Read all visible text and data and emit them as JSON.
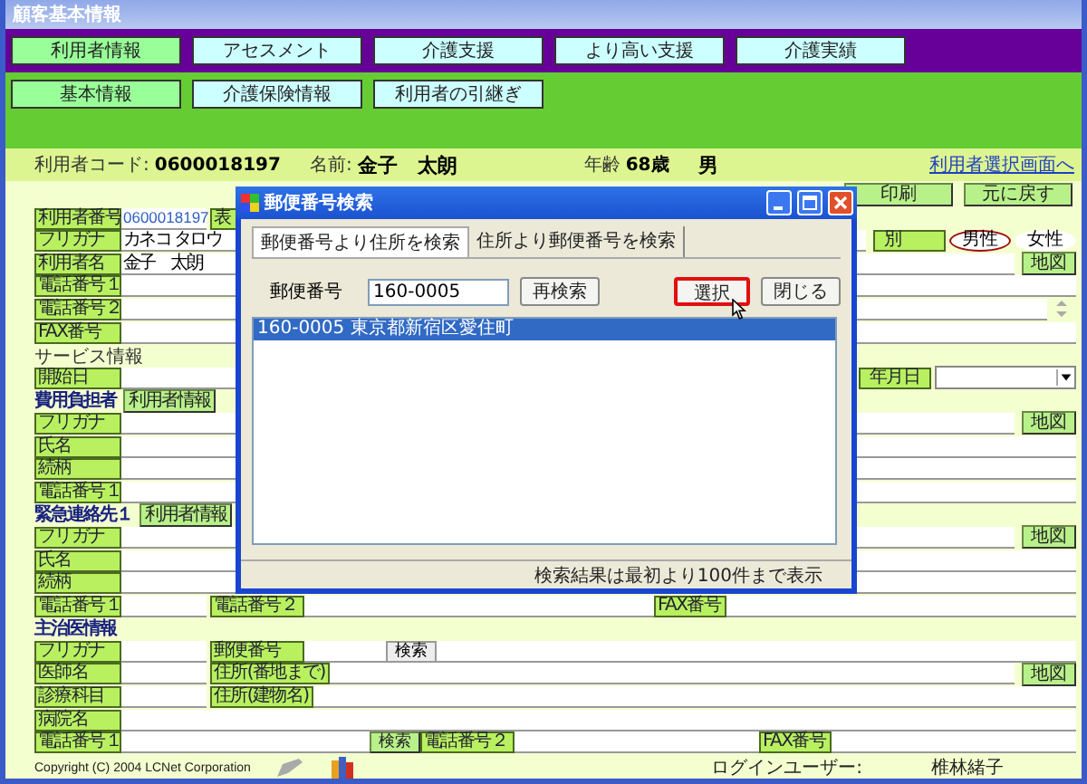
{
  "window": {
    "title": "顧客基本情報"
  },
  "main_tabs": [
    {
      "label": "利用者情報",
      "selected": true
    },
    {
      "label": "アセスメント",
      "selected": false
    },
    {
      "label": "介護支援",
      "selected": false
    },
    {
      "label": "より高い支援",
      "selected": false
    },
    {
      "label": "介護実績",
      "selected": false
    }
  ],
  "sub_tabs": [
    {
      "label": "基本情報",
      "selected": true
    },
    {
      "label": "介護保険情報",
      "selected": false
    },
    {
      "label": "利用者の引継ぎ",
      "selected": false
    }
  ],
  "header": {
    "code_label": "利用者コード:",
    "code": "0600018197",
    "name_label": "名前:",
    "name": "金子　太朗",
    "age_label": "年齢",
    "age": "68歳",
    "sex": "男",
    "link": "利用者選択画面へ"
  },
  "actions": [
    "印刷",
    "元に戻す"
  ],
  "form_rows": [
    {
      "kind": "field",
      "label": "利用者番号",
      "value": "0600018197",
      "readonly": true,
      "extra_label": "表"
    },
    {
      "kind": "field",
      "label": "フリガナ",
      "value": "カネコ タロウ",
      "readonly": false,
      "right": {
        "kind": "gender",
        "label": "別",
        "options": [
          {
            "label": "男性",
            "selected": true
          },
          {
            "label": "女性",
            "selected": false
          }
        ]
      }
    },
    {
      "kind": "field",
      "label": "利用者名",
      "value": "金子　太朗",
      "readonly": false,
      "right": {
        "kind": "button",
        "label": "地図"
      }
    },
    {
      "kind": "field",
      "label": "電話番号１"
    },
    {
      "kind": "field",
      "label": "電話番号２",
      "right": {
        "kind": "scroll"
      }
    },
    {
      "kind": "field",
      "label": "FAX番号"
    },
    {
      "kind": "note",
      "text": "サービス情報"
    },
    {
      "kind": "field",
      "label": "開始日",
      "right": {
        "kind": "date",
        "label": "年月日"
      }
    },
    {
      "kind": "heading",
      "text": "費用負担者",
      "button": "利用者情報"
    },
    {
      "kind": "field",
      "label": "フリガナ",
      "right": {
        "kind": "button",
        "label": "地図"
      }
    },
    {
      "kind": "field",
      "label": "氏名"
    },
    {
      "kind": "field",
      "label": "続柄"
    },
    {
      "kind": "field",
      "label": "電話番号１"
    },
    {
      "kind": "heading",
      "text": "緊急連絡先１",
      "button": "利用者情報"
    },
    {
      "kind": "field",
      "label": "フリガナ",
      "right": {
        "kind": "button",
        "label": "地図"
      }
    },
    {
      "kind": "field",
      "label": "氏名"
    },
    {
      "kind": "field",
      "label": "続柄"
    },
    {
      "kind": "field",
      "label": "電話番号１",
      "mid": {
        "label": "電話番号２"
      },
      "far": {
        "label": "FAX番号"
      }
    },
    {
      "kind": "heading",
      "text": "主治医情報"
    },
    {
      "kind": "field",
      "label": "フリガナ",
      "mid": {
        "label": "郵便番号",
        "button": "検索"
      }
    },
    {
      "kind": "field",
      "label": "医師名",
      "mid": {
        "label": "住所(番地まで)"
      },
      "right": {
        "kind": "button",
        "label": "地図"
      }
    },
    {
      "kind": "field",
      "label": "診療科目",
      "mid": {
        "label": "住所(建物名)"
      }
    },
    {
      "kind": "field",
      "label": "病院名"
    },
    {
      "kind": "field",
      "label": "電話番号１",
      "button": "検索",
      "mid": {
        "label": "電話番号２"
      },
      "far": {
        "label": "FAX番号"
      }
    }
  ],
  "dialog": {
    "title": "郵便番号検索",
    "tabs": [
      {
        "label": "郵便番号より住所を検索",
        "selected": true
      },
      {
        "label": "住所より郵便番号を検索",
        "selected": false
      }
    ],
    "zip_label": "郵便番号",
    "zip_value": "160-0005",
    "research_button": "再検索",
    "select_button": "選択",
    "close_button": "閉じる",
    "results": [
      {
        "text": "160-0005 東京都新宿区愛住町",
        "selected": true
      }
    ],
    "status": "検索結果は最初より100件まで表示"
  },
  "footer": {
    "copyright": "Copyright (C) 2004 LCNet Corporation",
    "login_label": "ログインユーザー:",
    "user": "椎林緒子"
  }
}
